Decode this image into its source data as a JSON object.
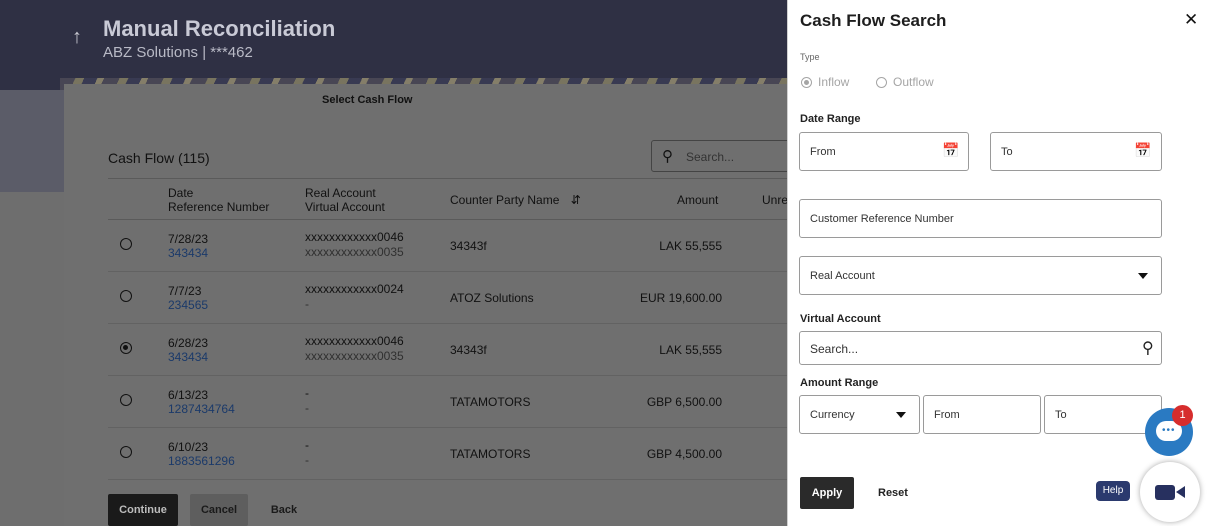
{
  "header": {
    "title": "Manual Reconciliation",
    "subtitle": "ABZ Solutions | ***462",
    "back_icon": "↑"
  },
  "main": {
    "section_title": "Select Cash Flow",
    "list_title": "Cash Flow (115)",
    "search_placeholder": "Search...",
    "columns": {
      "date_line1": "Date",
      "date_line2": "Reference Number",
      "account_line1": "Real Account",
      "account_line2": "Virtual Account",
      "counterparty": "Counter Party Name",
      "amount": "Amount",
      "unreconciled_partial": "Unre"
    },
    "rows": [
      {
        "date": "7/28/23",
        "ref": "343434",
        "real": "xxxxxxxxxxxx0046",
        "virtual": "xxxxxxxxxxxx0035",
        "party": "34343f",
        "amount": "LAK 55,555",
        "selected": false
      },
      {
        "date": "7/7/23",
        "ref": "234565",
        "real": "xxxxxxxxxxxx0024",
        "virtual": "-",
        "party": "ATOZ Solutions",
        "amount": "EUR 19,600.00",
        "selected": false
      },
      {
        "date": "6/28/23",
        "ref": "343434",
        "real": "xxxxxxxxxxxx0046",
        "virtual": "xxxxxxxxxxxx0035",
        "party": "34343f",
        "amount": "LAK 55,555",
        "selected": true
      },
      {
        "date": "6/13/23",
        "ref": "1287434764",
        "real": "-",
        "virtual": "-",
        "party": "TATAMOTORS",
        "amount": "GBP 6,500.00",
        "selected": false
      },
      {
        "date": "6/10/23",
        "ref": "1883561296",
        "real": "-",
        "virtual": "-",
        "party": "TATAMOTORS",
        "amount": "GBP 4,500.00",
        "selected": false
      }
    ],
    "buttons": {
      "continue": "Continue",
      "cancel": "Cancel",
      "back": "Back"
    }
  },
  "drawer": {
    "title": "Cash Flow Search",
    "close_icon": "✕",
    "type_label": "Type",
    "type_options": [
      "Inflow",
      "Outflow"
    ],
    "date_range_label": "Date Range",
    "from_placeholder": "From",
    "to_placeholder": "To",
    "customer_ref_placeholder": "Customer Reference Number",
    "real_account_placeholder": "Real Account",
    "virtual_account_label": "Virtual Account",
    "virtual_search_placeholder": "Search...",
    "amount_range_label": "Amount Range",
    "currency_placeholder": "Currency",
    "amount_from_placeholder": "From",
    "amount_to_placeholder": "To",
    "apply_label": "Apply",
    "reset_label": "Reset"
  },
  "widgets": {
    "help_label": "Help",
    "chat_badge": "1",
    "chat_dots": "•••"
  }
}
